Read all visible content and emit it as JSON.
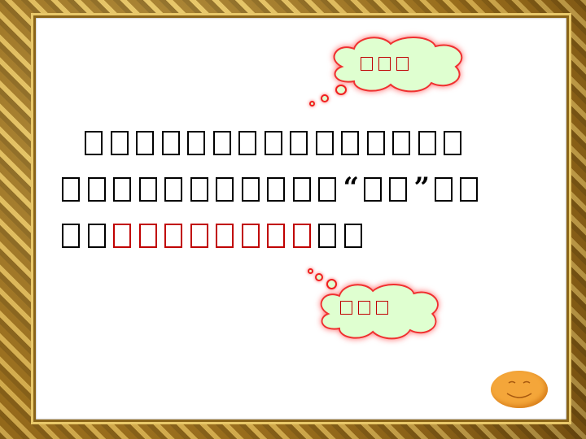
{
  "slide": {
    "line1": "□□□□□□□□□□□□□□□",
    "line2a": "□□□□□□□□□□□",
    "quote_open": "“",
    "line2b": "□□",
    "quote_close": "”",
    "line2c": "□□",
    "line3a": "□□",
    "line3_red": "□□□□□□□□",
    "line3b": "□□"
  },
  "cloud_top": {
    "label": "□□□"
  },
  "cloud_bottom": {
    "label": "□□□"
  },
  "colors": {
    "accent_red": "#c00000",
    "cloud_fill": "#dfffd0",
    "smiley": "#f4a63a"
  }
}
